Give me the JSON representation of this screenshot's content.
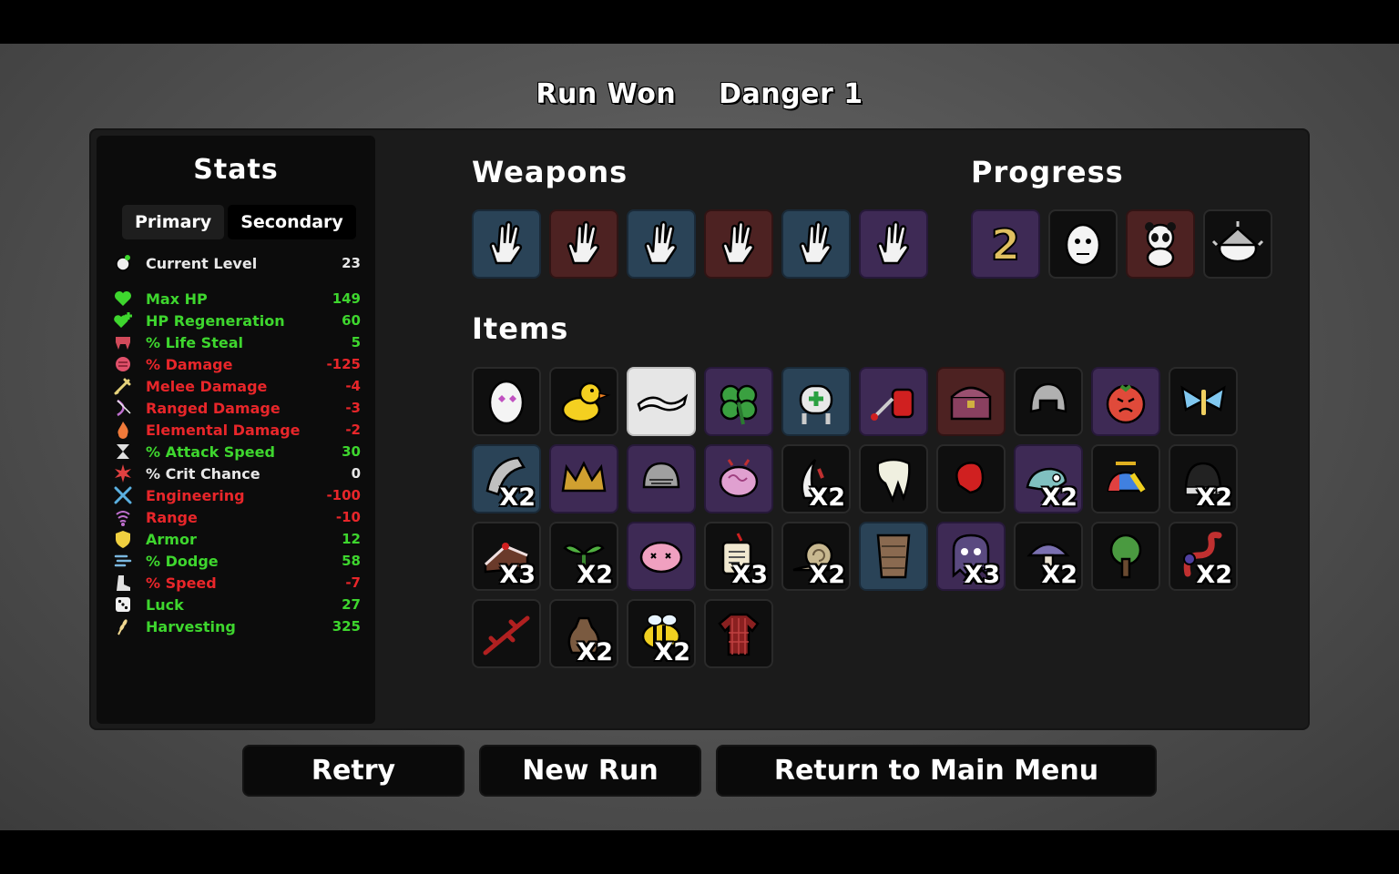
{
  "header": {
    "result": "Run Won",
    "danger": "Danger 1"
  },
  "stats": {
    "title": "Stats",
    "tabs": [
      {
        "label": "Primary",
        "active": false
      },
      {
        "label": "Secondary",
        "active": true
      }
    ],
    "current_level": {
      "label": "Current Level",
      "value": "23",
      "icon": "level-icon"
    },
    "rows": [
      {
        "label": "Max HP",
        "value": "149",
        "tone": "pos",
        "icon": "heart-icon",
        "color": "#3ed62e"
      },
      {
        "label": "HP Regeneration",
        "value": "60",
        "tone": "pos",
        "icon": "heart-plus-icon",
        "color": "#3ed62e"
      },
      {
        "label": "% Life Steal",
        "value": "5",
        "tone": "pos",
        "icon": "fangs-icon",
        "color": "#d24a5a"
      },
      {
        "label": "% Damage",
        "value": "-125",
        "tone": "neg",
        "icon": "fist-icon",
        "color": "#e0506a"
      },
      {
        "label": "Melee Damage",
        "value": "-4",
        "tone": "neg",
        "icon": "sword-icon",
        "color": "#e6d27a"
      },
      {
        "label": "Ranged Damage",
        "value": "-3",
        "tone": "neg",
        "icon": "bow-icon",
        "color": "#c070d0"
      },
      {
        "label": "Elemental Damage",
        "value": "-2",
        "tone": "neg",
        "icon": "flame-icon",
        "color": "#f07a3a"
      },
      {
        "label": "% Attack Speed",
        "value": "30",
        "tone": "pos",
        "icon": "hourglass-icon",
        "color": "#e0e0e0"
      },
      {
        "label": "% Crit Chance",
        "value": "0",
        "tone": "neu",
        "icon": "crit-burst-icon",
        "color": "#e04040"
      },
      {
        "label": "Engineering",
        "value": "-100",
        "tone": "neg",
        "icon": "wrench-icon",
        "color": "#5ab0e0"
      },
      {
        "label": "Range",
        "value": "-10",
        "tone": "neg",
        "icon": "range-waves-icon",
        "color": "#c070d0"
      },
      {
        "label": "Armor",
        "value": "12",
        "tone": "pos",
        "icon": "shield-icon",
        "color": "#f0d040"
      },
      {
        "label": "% Dodge",
        "value": "58",
        "tone": "pos",
        "icon": "dodge-wind-icon",
        "color": "#7ab8e0"
      },
      {
        "label": "% Speed",
        "value": "-7",
        "tone": "neg",
        "icon": "boot-icon",
        "color": "#e0e0e0"
      },
      {
        "label": "Luck",
        "value": "27",
        "tone": "pos",
        "icon": "dice-icon",
        "color": "#f0f0f0"
      },
      {
        "label": "Harvesting",
        "value": "325",
        "tone": "pos",
        "icon": "wheat-icon",
        "color": "#f0d890"
      }
    ]
  },
  "weapons": {
    "title": "Weapons",
    "slots": [
      {
        "icon": "hand-weapon-icon",
        "tier": "blue"
      },
      {
        "icon": "hand-weapon-icon",
        "tier": "red"
      },
      {
        "icon": "hand-weapon-icon",
        "tier": "blue"
      },
      {
        "icon": "hand-weapon-icon",
        "tier": "red"
      },
      {
        "icon": "hand-weapon-icon",
        "tier": "blue"
      },
      {
        "icon": "hand-weapon-icon",
        "tier": "purple"
      }
    ]
  },
  "progress": {
    "title": "Progress",
    "slots": [
      {
        "icon": "danger-number-icon",
        "tier": "purple",
        "text": "2"
      },
      {
        "icon": "character-portrait-icon",
        "tier": "gray",
        "text": ""
      },
      {
        "icon": "panda-icon",
        "tier": "red",
        "text": ""
      },
      {
        "icon": "spiked-dome-icon",
        "tier": "gray",
        "text": ""
      }
    ]
  },
  "items": {
    "title": "Items",
    "slots": [
      {
        "icon": "heart-eyes-egg-icon",
        "tier": "gray",
        "qty": ""
      },
      {
        "icon": "rubber-duck-icon",
        "tier": "gray",
        "qty": ""
      },
      {
        "icon": "lizard-icon",
        "tier": "white",
        "qty": ""
      },
      {
        "icon": "clover-icon",
        "tier": "purple",
        "qty": ""
      },
      {
        "icon": "medic-robot-icon",
        "tier": "blue",
        "qty": ""
      },
      {
        "icon": "blood-bag-icon",
        "tier": "purple",
        "qty": ""
      },
      {
        "icon": "treasure-chest-icon",
        "tier": "red",
        "qty": ""
      },
      {
        "icon": "helmet-icon",
        "tier": "gray",
        "qty": ""
      },
      {
        "icon": "angry-tomato-icon",
        "tier": "purple",
        "qty": ""
      },
      {
        "icon": "butterfly-icon",
        "tier": "gray",
        "qty": ""
      },
      {
        "icon": "metal-scrap-icon",
        "tier": "blue",
        "qty": "X2"
      },
      {
        "icon": "crown-icon",
        "tier": "purple",
        "qty": ""
      },
      {
        "icon": "knight-helmet-icon",
        "tier": "purple",
        "qty": ""
      },
      {
        "icon": "brain-icon",
        "tier": "purple",
        "qty": ""
      },
      {
        "icon": "claw-icon",
        "tier": "gray",
        "qty": "X2"
      },
      {
        "icon": "tooth-icon",
        "tier": "gray",
        "qty": ""
      },
      {
        "icon": "boxing-glove-icon",
        "tier": "gray",
        "qty": ""
      },
      {
        "icon": "chameleon-icon",
        "tier": "purple",
        "qty": "X2"
      },
      {
        "icon": "propeller-hat-icon",
        "tier": "gray",
        "qty": ""
      },
      {
        "icon": "beanie-icon",
        "tier": "gray",
        "qty": "X2"
      },
      {
        "icon": "cake-icon",
        "tier": "gray",
        "qty": "X3"
      },
      {
        "icon": "sprout-icon",
        "tier": "gray",
        "qty": "X2"
      },
      {
        "icon": "pink-blob-icon",
        "tier": "purple",
        "qty": ""
      },
      {
        "icon": "scroll-icon",
        "tier": "gray",
        "qty": "X3"
      },
      {
        "icon": "snail-icon",
        "tier": "gray",
        "qty": "X2"
      },
      {
        "icon": "plank-armor-icon",
        "tier": "blue",
        "qty": ""
      },
      {
        "icon": "ghost-icon",
        "tier": "purple",
        "qty": "X3"
      },
      {
        "icon": "mushroom-icon",
        "tier": "gray",
        "qty": "X2"
      },
      {
        "icon": "tree-icon",
        "tier": "gray",
        "qty": ""
      },
      {
        "icon": "snake-icon",
        "tier": "gray",
        "qty": "X2"
      },
      {
        "icon": "thorn-branch-icon",
        "tier": "gray",
        "qty": ""
      },
      {
        "icon": "sack-icon",
        "tier": "gray",
        "qty": "X2"
      },
      {
        "icon": "bee-icon",
        "tier": "gray",
        "qty": "X2"
      },
      {
        "icon": "flannel-shirt-icon",
        "tier": "gray",
        "qty": ""
      }
    ]
  },
  "buttons": {
    "retry": "Retry",
    "new_run": "New Run",
    "main_menu": "Return to Main Menu"
  }
}
